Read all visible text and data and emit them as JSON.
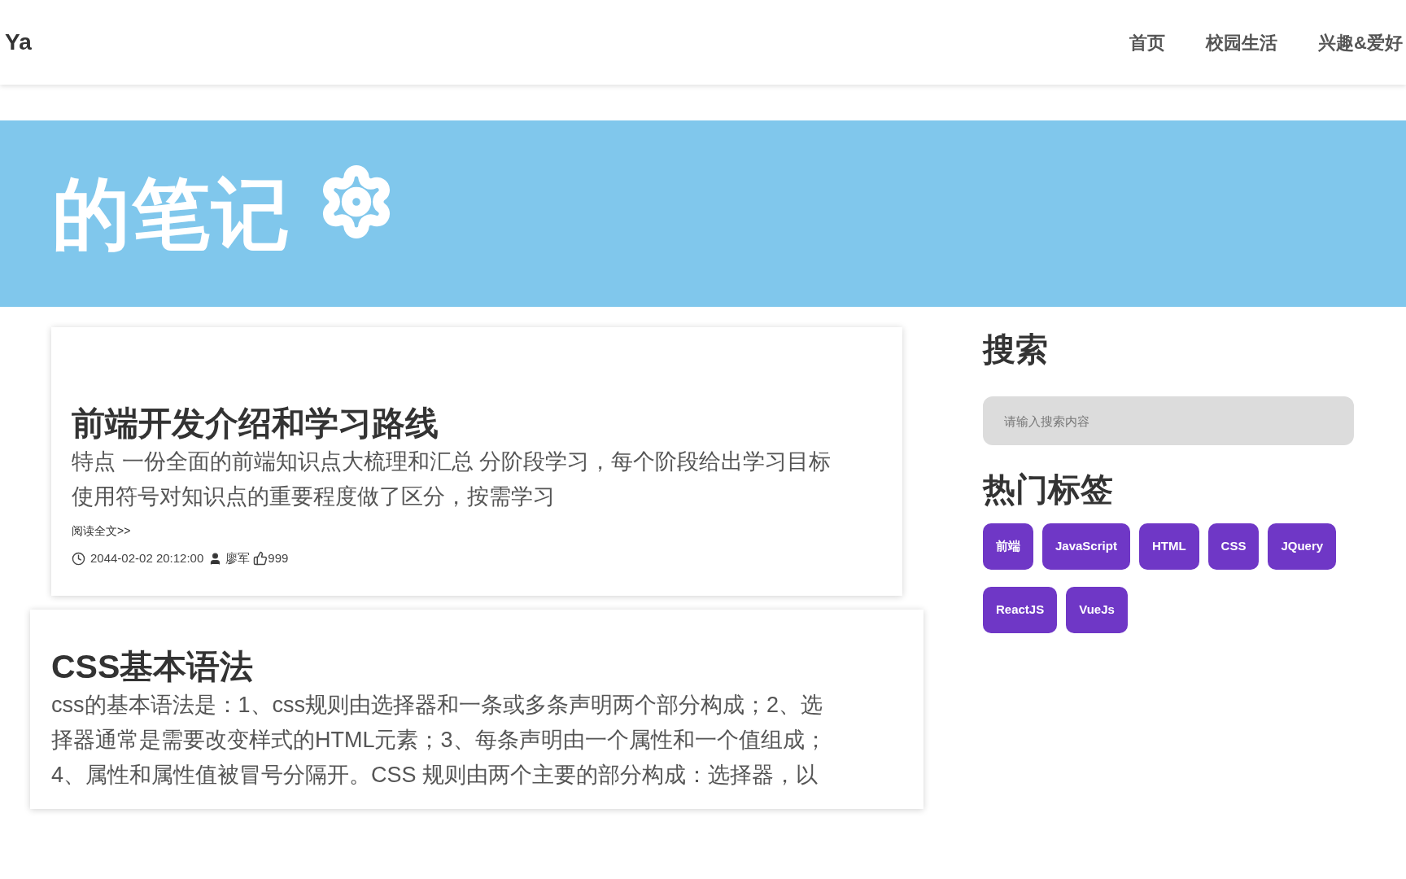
{
  "navbar": {
    "logo": "Ya",
    "links": [
      {
        "label": "首页"
      },
      {
        "label": "校园生活"
      },
      {
        "label": "兴趣&爱好"
      }
    ]
  },
  "banner": {
    "title": "的笔记"
  },
  "posts": [
    {
      "title": "前端开发介绍和学习路线",
      "summary": [
        "特点 一份全面的前端知识点大梳理和汇总 分阶段学习，每个阶段给出学习目标",
        "使用符号对知识点的重要程度做了区分，按需学习"
      ],
      "read_more": "阅读全文>>",
      "date": "2044-02-02 20:12:00",
      "author": "廖军",
      "likes": "999"
    },
    {
      "title": "CSS基本语法",
      "summary": [
        "css的基本语法是：1、css规则由选择器和一条或多条声明两个部分构成；2、选",
        "择器通常是需要改变样式的HTML元素；3、每条声明由一个属性和一个值组成；",
        "4、属性和属性值被冒号分隔开。CSS 规则由两个主要的部分构成：选择器，以"
      ]
    }
  ],
  "sidebar": {
    "search_heading": "搜索",
    "search": {
      "placeholder": "请输入搜索内容"
    },
    "tags_heading": "热门标签",
    "tags": [
      "前端",
      "JavaScript",
      "HTML",
      "CSS",
      "JQuery",
      "ReactJS",
      "VueJs"
    ]
  }
}
